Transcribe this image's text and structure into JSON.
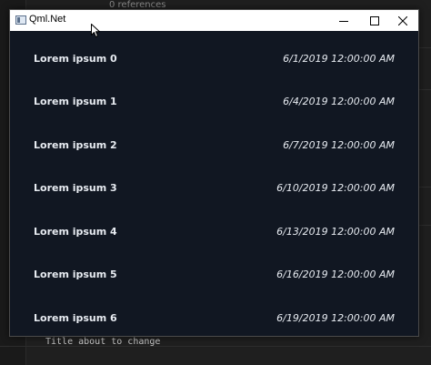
{
  "background_editor": {
    "codelens_text": "0 references",
    "code_line": "Title about to change"
  },
  "window": {
    "title": "Qml.Net",
    "icon": "app-window-icon",
    "controls": {
      "minimize_icon": "minimize-icon",
      "maximize_icon": "maximize-icon",
      "close_icon": "close-icon"
    }
  },
  "items": [
    {
      "title": "Lorem ipsum 0",
      "date": "6/1/2019 12:00:00 AM"
    },
    {
      "title": "Lorem ipsum 1",
      "date": "6/4/2019 12:00:00 AM"
    },
    {
      "title": "Lorem ipsum 2",
      "date": "6/7/2019 12:00:00 AM"
    },
    {
      "title": "Lorem ipsum 3",
      "date": "6/10/2019 12:00:00 AM"
    },
    {
      "title": "Lorem ipsum 4",
      "date": "6/13/2019 12:00:00 AM"
    },
    {
      "title": "Lorem ipsum 5",
      "date": "6/16/2019 12:00:00 AM"
    },
    {
      "title": "Lorem ipsum 6",
      "date": "6/19/2019 12:00:00 AM"
    }
  ],
  "colors": {
    "window_background": "#111722",
    "titlebar_background": "#ffffff",
    "item_text": "#e8ecf2",
    "editor_background": "#1f1f1f"
  }
}
